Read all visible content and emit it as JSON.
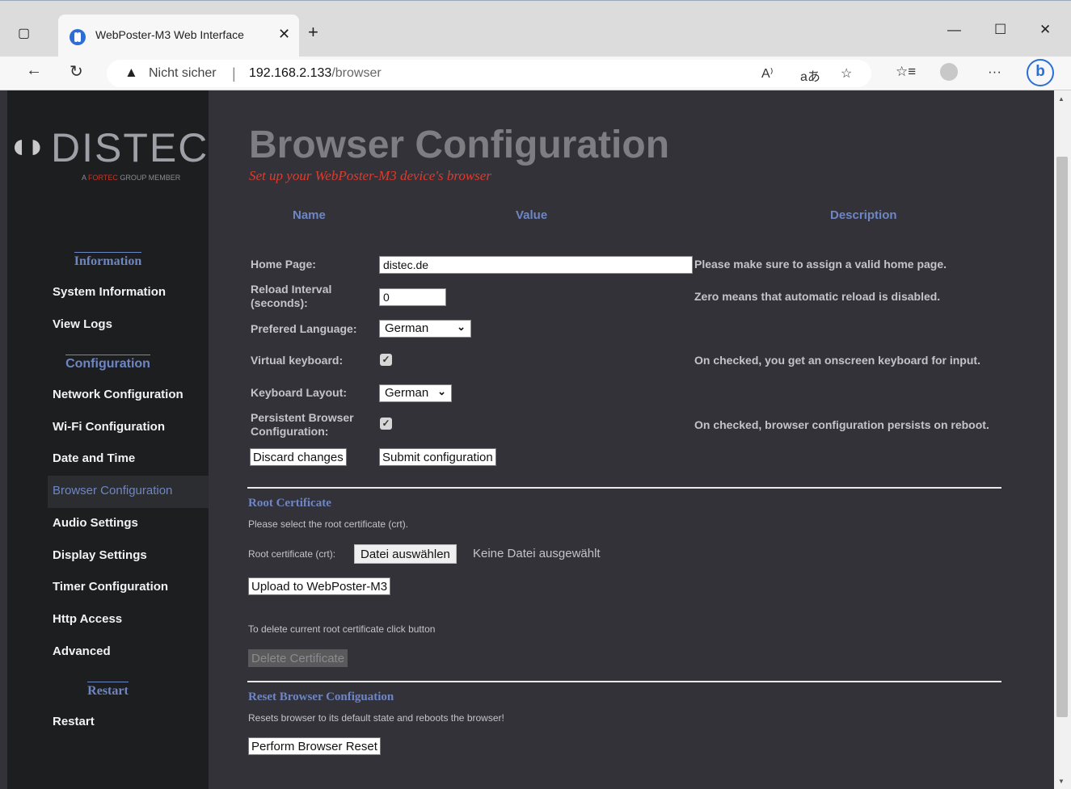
{
  "browser": {
    "tab_title": "WebPoster-M3 Web Interface",
    "security_label": "Nicht sicher",
    "url_host": "192.168.2.133",
    "url_path": "/browser"
  },
  "sidebar": {
    "logo_text": "DISTEC",
    "logo_sub_prefix": "A ",
    "logo_sub_highlight": "FORTEC",
    "logo_sub_suffix": " GROUP MEMBER",
    "sections": [
      {
        "heading": "Information",
        "items": [
          "System Information",
          "View Logs"
        ]
      },
      {
        "heading": "Configuration",
        "items": [
          "Network Configuration",
          "Wi-Fi Configuration",
          "Date and Time",
          "Browser Configuration",
          "Audio Settings",
          "Display Settings",
          "Timer Configuration",
          "Http Access",
          "Advanced"
        ]
      },
      {
        "heading": "Restart",
        "items": [
          "Restart"
        ]
      }
    ],
    "active_item": "Browser Configuration"
  },
  "main": {
    "title": "Browser Configuration",
    "subtitle": "Set up your WebPoster-M3 device's browser",
    "columns": {
      "name": "Name",
      "value": "Value",
      "description": "Description"
    },
    "form": {
      "home_page": {
        "label": "Home Page:",
        "value": "distec.de",
        "description": "Please make sure to assign a valid home page."
      },
      "reload_interval": {
        "label_line1": "Reload Interval",
        "label_line2": "(seconds):",
        "value": "0",
        "description": "Zero means that automatic reload is disabled."
      },
      "language": {
        "label": "Prefered Language:",
        "selected": "German"
      },
      "virtual_keyboard": {
        "label": "Virtual keyboard:",
        "checked": true,
        "description": "On checked, you get an onscreen keyboard for input."
      },
      "keyboard_layout": {
        "label": "Keyboard Layout:",
        "selected": "German"
      },
      "persistent": {
        "label_line1": "Persistent Browser",
        "label_line2": "Configuration:",
        "checked": true,
        "description": "On checked, browser configuration persists on reboot."
      },
      "discard_label": "Discard changes",
      "submit_label": "Submit configuration"
    },
    "root_cert": {
      "title": "Root Certificate",
      "note": "Please select the root certificate (crt).",
      "file_label": "Root certificate (crt):",
      "choose_file": "Datei auswählen",
      "no_file": "Keine Datei ausgewählt",
      "upload_label": "Upload to WebPoster-M3",
      "delete_note": "To delete current root certificate click button",
      "delete_label": "Delete Certificate"
    },
    "reset": {
      "title": "Reset Browser Configuation",
      "note": "Resets browser to its default state and reboots the browser!",
      "button_label": "Perform Browser Reset"
    }
  }
}
